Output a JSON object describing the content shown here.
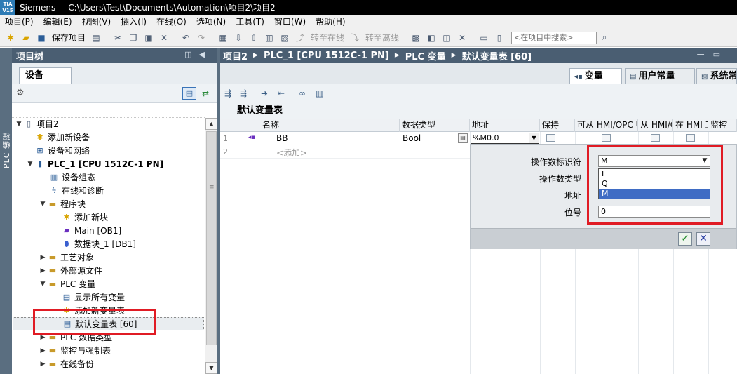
{
  "titlebar": {
    "logo_line1": "TIA",
    "logo_line2": "V15",
    "app_name": "Siemens",
    "path": "C:\\Users\\Test\\Documents\\Automation\\项目2\\项目2"
  },
  "menu": [
    "项目(P)",
    "编辑(E)",
    "视图(V)",
    "插入(I)",
    "在线(O)",
    "选项(N)",
    "工具(T)",
    "窗口(W)",
    "帮助(H)"
  ],
  "toolbar": {
    "save_project": "保存项目",
    "go_online": "转至在线",
    "go_offline": "转至离线",
    "search_placeholder": "<在项目中搜索>"
  },
  "left_strip": {
    "label": "PLC 编程"
  },
  "project_tree": {
    "header": "项目树",
    "tab_devices": "设备",
    "items": [
      {
        "label": "项目2"
      },
      {
        "label": "添加新设备"
      },
      {
        "label": "设备和网络"
      },
      {
        "label": "PLC_1 [CPU 1512C-1 PN]"
      },
      {
        "label": "设备组态"
      },
      {
        "label": "在线和诊断"
      },
      {
        "label": "程序块"
      },
      {
        "label": "添加新块"
      },
      {
        "label": "Main [OB1]"
      },
      {
        "label": "数据块_1 [DB1]"
      },
      {
        "label": "工艺对象"
      },
      {
        "label": "外部源文件"
      },
      {
        "label": "PLC 变量"
      },
      {
        "label": "显示所有变量"
      },
      {
        "label": "添加新变量表"
      },
      {
        "label": "默认变量表 [60]"
      },
      {
        "label": "PLC 数据类型"
      },
      {
        "label": "监控与强制表"
      },
      {
        "label": "在线备份"
      }
    ]
  },
  "breadcrumb": [
    "项目2",
    "PLC_1 [CPU 1512C-1 PN]",
    "PLC 变量",
    "默认变量表 [60]"
  ],
  "editor_tabs": {
    "variables": "变量",
    "user_constants": "用户常量",
    "system_constants": "系统常量"
  },
  "table": {
    "title": "默认变量表",
    "columns": [
      "名称",
      "数据类型",
      "地址",
      "保持",
      "可从 HMI/OPC UA 访问",
      "从 HMI/OPC UA 可写",
      "在 HMI 工程组态中可见",
      "监控"
    ],
    "rows": [
      {
        "num": "1",
        "name": "BB",
        "type": "Bool",
        "address": "%M0.0"
      },
      {
        "num": "2",
        "name": "<添加>"
      }
    ]
  },
  "address_popup": {
    "label_operand_id": "操作数标识符",
    "label_operand_type": "操作数类型",
    "label_address": "地址",
    "label_bit": "位号",
    "operand_id_value": "M",
    "bit_value": "0",
    "options": [
      "I",
      "Q",
      "M"
    ],
    "selected_option": "M"
  },
  "colors": {
    "highlight": "#e01b24",
    "header_bar": "#4a5e72",
    "selected_option": "#3f6cc4"
  }
}
